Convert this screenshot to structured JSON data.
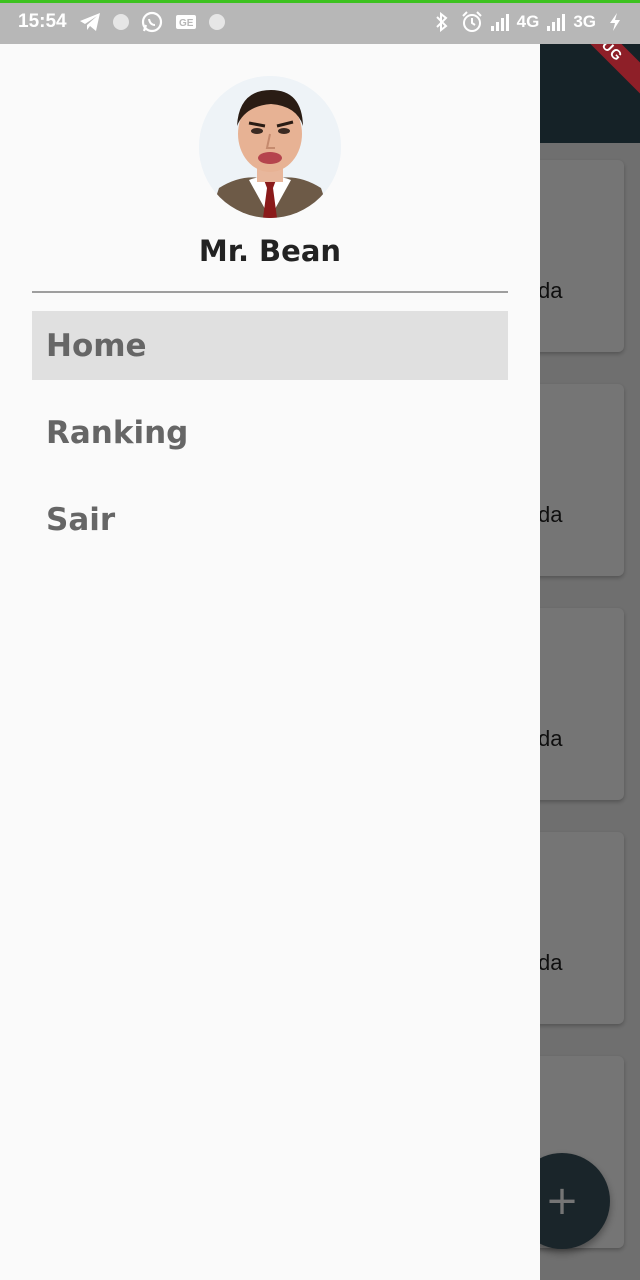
{
  "status_bar": {
    "time": "15:54",
    "left_icons": [
      "telegram-icon",
      "circle-notification-icon",
      "whatsapp-icon",
      "ge-icon",
      "circle-notification-icon"
    ],
    "network_1": "4G",
    "network_2": "3G",
    "right_icons": [
      "bluetooth-icon",
      "alarm-icon",
      "signal-icon",
      "signal-icon",
      "charging-icon"
    ]
  },
  "debug_banner": "DEBUG",
  "drawer": {
    "user_name": "Mr. Bean",
    "items": [
      {
        "label": "Home",
        "selected": true
      },
      {
        "label": "Ranking",
        "selected": false
      },
      {
        "label": "Sair",
        "selected": false
      }
    ]
  },
  "background": {
    "card_text": "da",
    "fab_icon": "add-icon",
    "fab_label": "+"
  },
  "colors": {
    "accent_app_bar": "#2f4a55",
    "status_bar": "#b7b7b7",
    "selected_item": "#e0e0e0",
    "debug_ribbon": "#8e1f28"
  }
}
